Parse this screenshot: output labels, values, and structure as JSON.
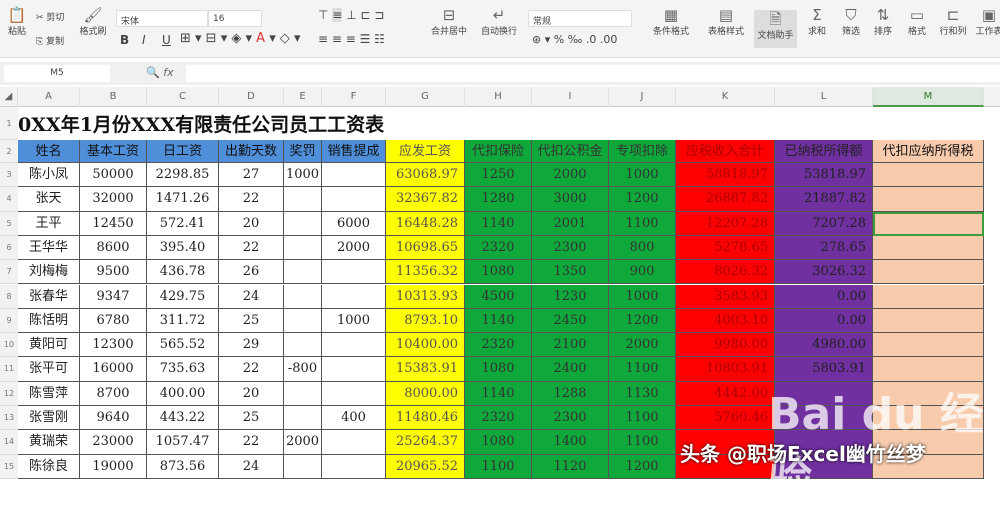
{
  "ribbon": {
    "paste": "粘贴",
    "cut": "剪切",
    "copy": "复制",
    "format_painter": "格式刷",
    "font_name": "宋体",
    "font_size": "16",
    "bold": "B",
    "italic": "I",
    "underline": "U",
    "merge_center": "合并居中",
    "wrap_text": "自动换行",
    "number_format": "常规",
    "percent": "%",
    "conditional_format": "条件格式",
    "table_style": "表格样式",
    "doc_assistant": "文档助手",
    "sum": "求和",
    "filter": "筛选",
    "sort": "排序",
    "format": "格式",
    "row_col": "行和列",
    "worksheet": "工作表"
  },
  "formula_bar": {
    "name_box": "M5",
    "fx": "fx",
    "value": ""
  },
  "columns": [
    "A",
    "B",
    "C",
    "D",
    "E",
    "F",
    "G",
    "H",
    "I",
    "J",
    "K",
    "L",
    "M"
  ],
  "sheet": {
    "title": "0XX年1月份XXX有限责任公司员工工资表",
    "headers": [
      "姓名",
      "基本工资",
      "日工资",
      "出勤天数",
      "奖罚",
      "销售提成",
      "应发工资",
      "代扣保险",
      "代扣公积金",
      "专项扣除",
      "应税收入合计",
      "已纳税所得额",
      "代扣应纳所得税"
    ],
    "row_numbers": [
      "1",
      "2",
      "3",
      "4",
      "5",
      "6",
      "7",
      "8",
      "9",
      "10",
      "11",
      "12",
      "13",
      "14",
      "15"
    ],
    "rows": [
      [
        "陈小凤",
        "50000",
        "2298.85",
        "27",
        "1000",
        "",
        "63068.97",
        "1250",
        "2000",
        "1000",
        "58818.97",
        "53818.97",
        ""
      ],
      [
        "张天",
        "32000",
        "1471.26",
        "22",
        "",
        "",
        "32367.82",
        "1280",
        "3000",
        "1200",
        "26887.82",
        "21887.82",
        ""
      ],
      [
        "王平",
        "12450",
        "572.41",
        "20",
        "",
        "6000",
        "16448.28",
        "1140",
        "2001",
        "1100",
        "12207.28",
        "7207.28",
        ""
      ],
      [
        "王华华",
        "8600",
        "395.40",
        "22",
        "",
        "2000",
        "10698.65",
        "2320",
        "2300",
        "800",
        "5278.65",
        "278.65",
        ""
      ],
      [
        "刘梅梅",
        "9500",
        "436.78",
        "26",
        "",
        "",
        "11356.32",
        "1080",
        "1350",
        "900",
        "8026.32",
        "3026.32",
        ""
      ],
      [
        "张春华",
        "9347",
        "429.75",
        "24",
        "",
        "",
        "10313.93",
        "4500",
        "1230",
        "1000",
        "3583.93",
        "0.00",
        ""
      ],
      [
        "陈恬明",
        "6780",
        "311.72",
        "25",
        "",
        "1000",
        "8793.10",
        "1140",
        "2450",
        "1200",
        "4003.10",
        "0.00",
        ""
      ],
      [
        "黄阳可",
        "12300",
        "565.52",
        "29",
        "",
        "",
        "10400.00",
        "2320",
        "2100",
        "2000",
        "9980.00",
        "4980.00",
        ""
      ],
      [
        "张平可",
        "16000",
        "735.63",
        "22",
        "-800",
        "",
        "15383.91",
        "1080",
        "2400",
        "1100",
        "10803.91",
        "5803.91",
        ""
      ],
      [
        "陈雪萍",
        "8700",
        "400.00",
        "20",
        "",
        "",
        "8000.00",
        "1140",
        "1288",
        "1130",
        "4442.00",
        "",
        ""
      ],
      [
        "张雪刚",
        "9640",
        "443.22",
        "25",
        "",
        "400",
        "11480.46",
        "2320",
        "2300",
        "1100",
        "5760.46",
        "",
        ""
      ],
      [
        "黄瑞荣",
        "23000",
        "1057.47",
        "22",
        "2000",
        "",
        "25264.37",
        "1080",
        "1400",
        "1100",
        "",
        "",
        ""
      ],
      [
        "陈徐良",
        "19000",
        "873.56",
        "24",
        "",
        "",
        "20965.52",
        "1100",
        "1120",
        "1200",
        "",
        "",
        ""
      ]
    ]
  },
  "watermark": {
    "baidu": "Bai du 经验",
    "toutiao": "头条 @职场Excel幽竹丝梦"
  }
}
